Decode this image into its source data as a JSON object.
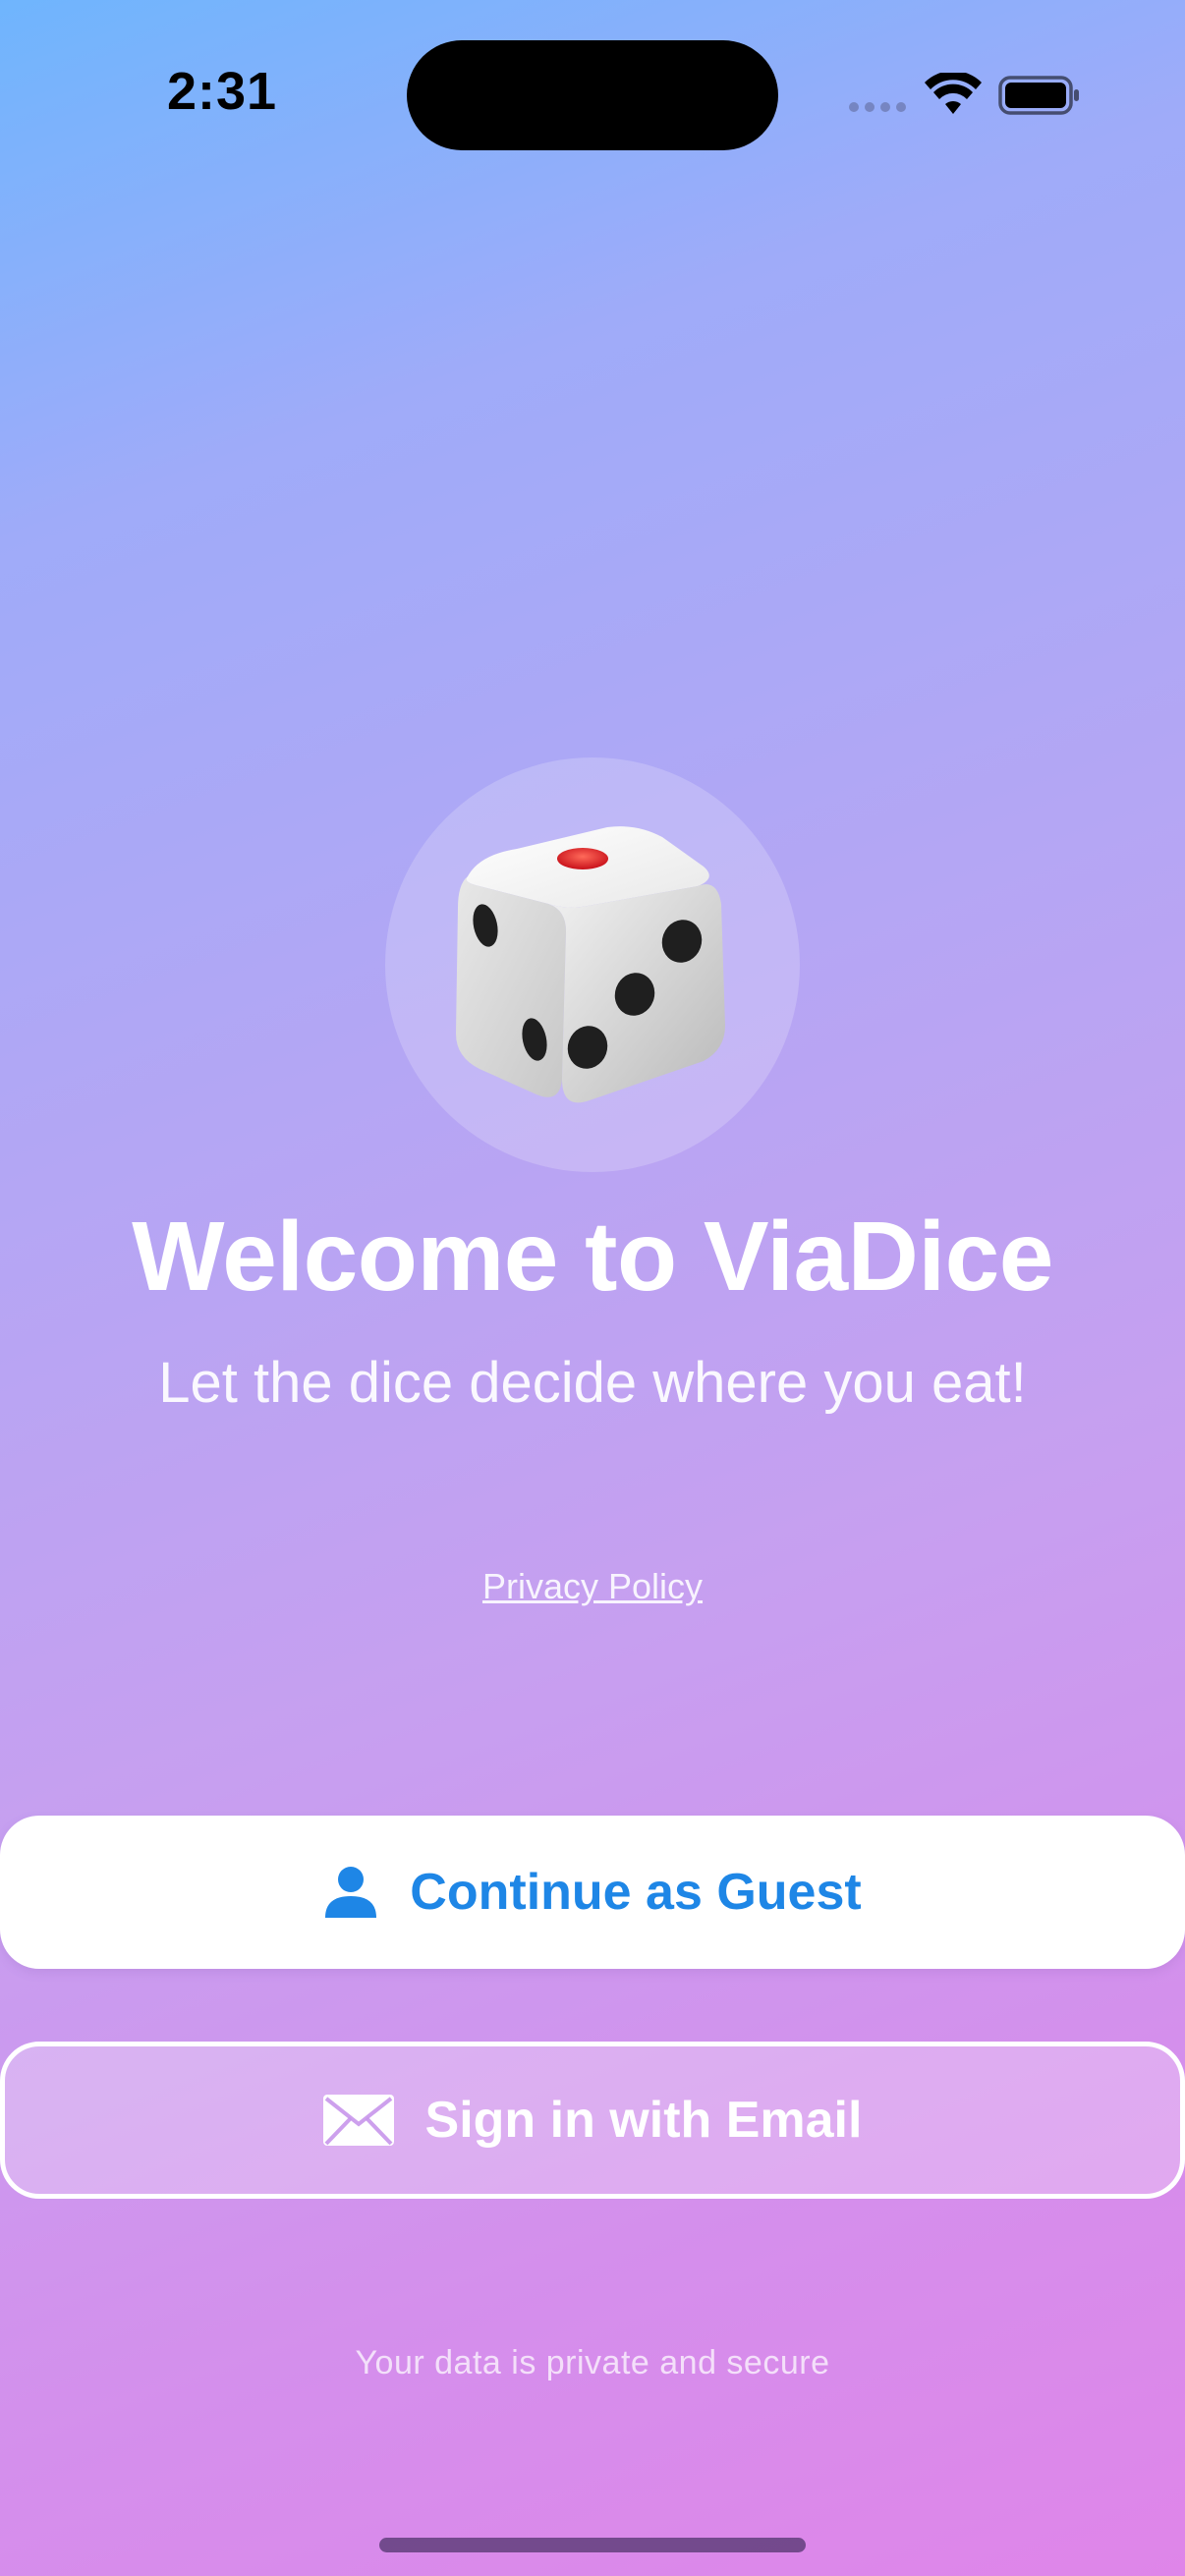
{
  "status_bar": {
    "time": "2:31"
  },
  "hero": {
    "icon": "dice-icon",
    "title": "Welcome to ViaDice",
    "subtitle": "Let the dice decide where you eat!"
  },
  "links": {
    "privacy_policy": "Privacy Policy"
  },
  "buttons": {
    "guest": {
      "label": "Continue as Guest",
      "icon": "person-icon"
    },
    "email": {
      "label": "Sign in with Email",
      "icon": "envelope-icon"
    }
  },
  "footer": {
    "note": "Your data is private and secure"
  },
  "colors": {
    "accent": "#1e86e6",
    "gradient_top": "#6fb5fd",
    "gradient_bottom": "#df85e9"
  }
}
